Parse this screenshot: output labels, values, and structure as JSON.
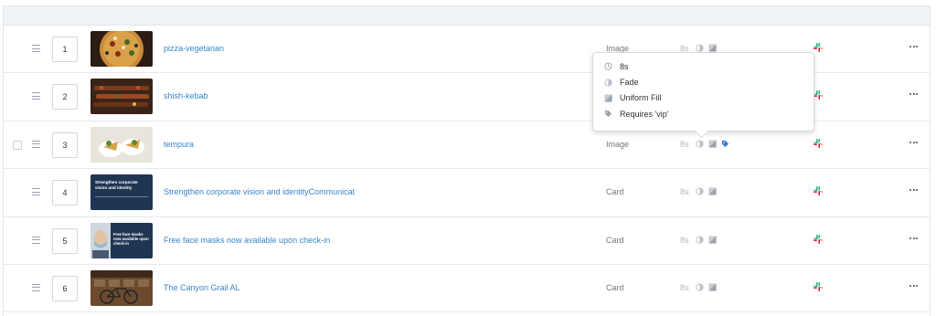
{
  "rows": [
    {
      "order": "1",
      "name": "pizza-vegetarian",
      "type": "Image",
      "duration": "8s",
      "thumb_icon": "pizza-thumbnail"
    },
    {
      "order": "2",
      "name": "shish-kebab",
      "type": "Image",
      "duration": "8s",
      "thumb_icon": "kebab-thumbnail"
    },
    {
      "order": "3",
      "name": "tempura",
      "type": "Image",
      "duration": "8s",
      "thumb_icon": "tempura-thumbnail",
      "has_tag": true
    },
    {
      "order": "4",
      "name": "Strengthen corporate vision and identityCommunicat",
      "type": "Card",
      "duration": "8s",
      "thumb_icon": "card-thumbnail",
      "thumb_text": "Strengthen corporate vision and identity"
    },
    {
      "order": "5",
      "name": "Free face masks now available upon check-in",
      "type": "Card",
      "duration": "8s",
      "thumb_icon": "card-thumbnail",
      "thumb_text": "Free face masks now available upon check-in"
    },
    {
      "order": "6",
      "name": "The Canyon Grail AL",
      "type": "Card",
      "duration": "8s",
      "thumb_icon": "bike-thumbnail"
    }
  ],
  "tooltip": {
    "duration": "8s",
    "transition": "Fade",
    "fill": "Uniform Fill",
    "requirement": "Requires 'vip'"
  },
  "colors": {
    "link": "#3a84c9",
    "header_bg": "#f0f3f7",
    "tag": "#3a7bd5"
  }
}
